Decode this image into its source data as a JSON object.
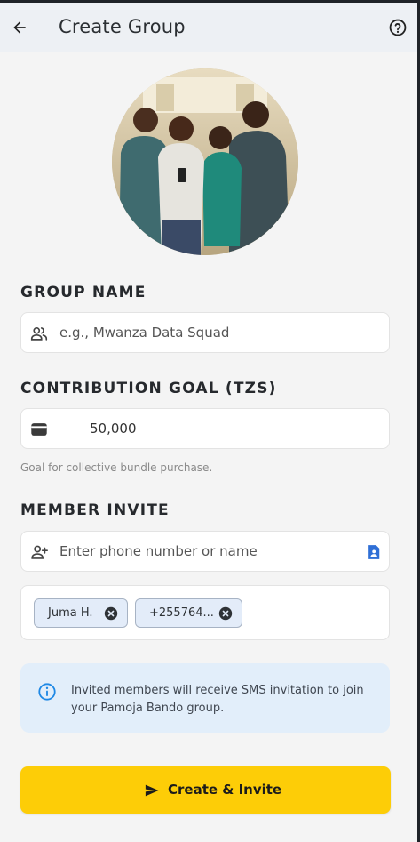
{
  "app": {
    "title": "Create Group"
  },
  "group_name": {
    "label": "GROUP NAME",
    "placeholder": "e.g., Mwanza Data Squad",
    "icon": "group-icon"
  },
  "contribution": {
    "label": "CONTRIBUTION GOAL (TZS)",
    "value": "50,000",
    "helper": "Goal for collective bundle purchase.",
    "icon": "wallet-icon"
  },
  "member_invite": {
    "label": "MEMBER INVITE",
    "placeholder": "Enter phone number or name",
    "icon": "person-add-icon",
    "contacts_icon": "contacts-icon",
    "chips": [
      {
        "label": "Juma H."
      },
      {
        "label": "+255764..."
      }
    ]
  },
  "info": {
    "text": "Invited members will receive SMS invitation to join your Pamoja Bando group."
  },
  "cta": {
    "label": "Create & Invite",
    "icon": "send-icon"
  },
  "colors": {
    "accent": "#fdcd07",
    "info_bg": "#e2eefa",
    "info_icon": "#1e88e5",
    "contacts_icon": "#2f6fd6"
  }
}
